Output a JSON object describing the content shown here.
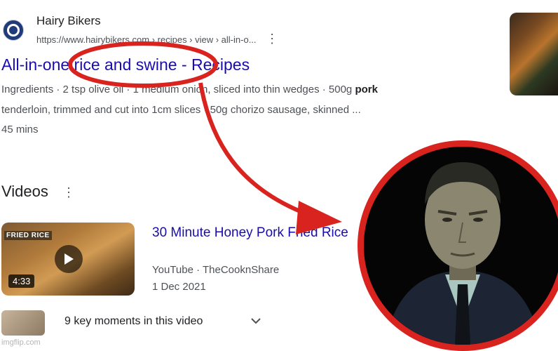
{
  "result": {
    "site_name": "Hairy Bikers",
    "url": "https://www.hairybikers.com › recipes › view › all-in-o...",
    "more_icon": "more-vert-icon",
    "title": "All-in-one rice and swine - Recipes",
    "snippet_line1_pre": "Ingredients · 2 tsp olive oil · 1 medium onion, sliced into thin wedges · 500g ",
    "snippet_line1_bold": "pork",
    "snippet_line2": "tenderloin, trimmed and cut into 1cm slices · 50g chorizo sausage, skinned ...",
    "snippet_line3": "45 mins"
  },
  "videos": {
    "heading": "Videos",
    "more_icon": "more-vert-icon",
    "items": [
      {
        "badge": "FRIED RICE",
        "duration": "4:33",
        "title": "30 Minute Honey Pork Fried Rice",
        "source": "YouTube · TheCooknShare",
        "date": "1 Dec 2021",
        "key_moments": "9 key moments in this video"
      }
    ]
  },
  "watermark": "imgflip.com",
  "colors": {
    "link": "#1a0dab",
    "annotation_red": "#d8231f",
    "text": "#202124",
    "secondary_text": "#4d5156"
  }
}
